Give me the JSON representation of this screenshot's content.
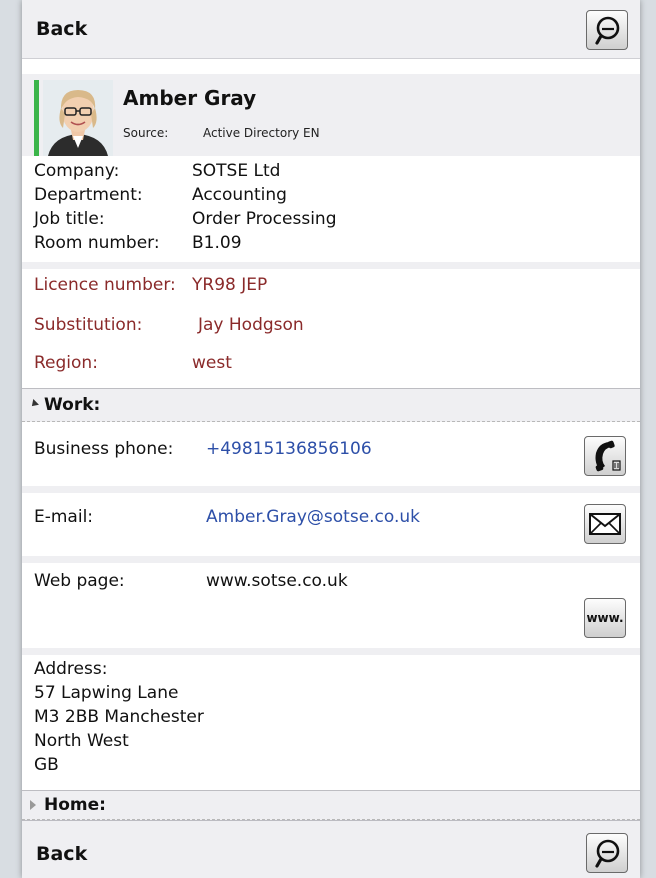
{
  "top_bar": {
    "back_label": "Back",
    "search_icon": "search-icon"
  },
  "contact": {
    "name": "Amber Gray",
    "source_label": "Source:",
    "source_value": "Active Directory EN",
    "accent_color": "#3bb54a"
  },
  "details": [
    {
      "label": "Company:",
      "value": "SOTSE Ltd"
    },
    {
      "label": "Department:",
      "value": "Accounting"
    },
    {
      "label": "Job title:",
      "value": "Order Processing"
    },
    {
      "label": "Room number:",
      "value": "B1.09"
    }
  ],
  "custom_fields": [
    {
      "label": "Licence number:",
      "value": "YR98 JEP"
    },
    {
      "label": "Substitution:",
      "value": "Jay Hodgson"
    },
    {
      "label": "Region:",
      "value": "west"
    }
  ],
  "work": {
    "title": "Work:",
    "business_phone": {
      "label": "Business phone:",
      "value": "+49815136856106",
      "icon": "phone-icon"
    },
    "email": {
      "label": "E-mail:",
      "value": "Amber.Gray@sotse.co.uk",
      "icon": "envelope-icon"
    },
    "web": {
      "label": "Web page:",
      "value": "www.sotse.co.uk",
      "icon_text": "www."
    },
    "address_label": "Address:",
    "address_lines": [
      "57 Lapwing Lane",
      "M3 2BB Manchester",
      "North West",
      "GB"
    ]
  },
  "home": {
    "title": "Home:"
  },
  "bottom_bar": {
    "back_label": "Back",
    "search_icon": "search-icon"
  },
  "colors": {
    "custom_field_text": "#8a2a2a",
    "link_text": "#2d4fa8"
  }
}
